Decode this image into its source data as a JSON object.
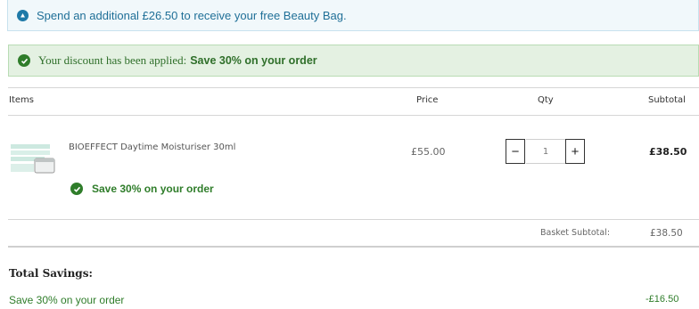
{
  "free_gift_banner": {
    "icon": "info-icon",
    "text": "Spend an additional £26.50 to receive your free Beauty Bag."
  },
  "discount_banner": {
    "icon": "checkmark-icon",
    "text": "Your discount has been applied:",
    "strong": "Save 30% on your order"
  },
  "table": {
    "headers": {
      "items": "Items",
      "price": "Price",
      "qty": "Qty",
      "subtotal": "Subtotal"
    }
  },
  "line_item": {
    "name": "BIOEFFECT Daytime Moisturiser 30ml",
    "price": "£55.00",
    "quantity": "1",
    "decrease_label": "−",
    "increase_label": "+",
    "subtotal": "£38.50",
    "promo": "Save 30% on your order"
  },
  "basket": {
    "subtotal_label": "Basket Subtotal:",
    "subtotal_value": "£38.50"
  },
  "savings": {
    "title": "Total Savings:",
    "label": "Save 30% on your order",
    "value": "-£16.50"
  },
  "colors": {
    "info": "#1f7aa8",
    "success": "#2f7d2a"
  }
}
